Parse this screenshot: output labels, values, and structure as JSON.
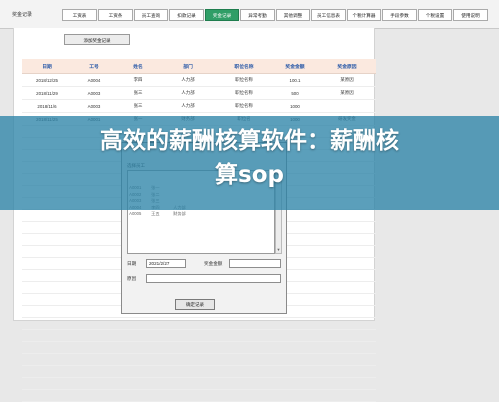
{
  "app_title": "奖金记录",
  "tabs": [
    {
      "label": "工资表",
      "active": false
    },
    {
      "label": "工资条",
      "active": false
    },
    {
      "label": "员工查询",
      "active": false
    },
    {
      "label": "扣款记录",
      "active": false
    },
    {
      "label": "奖金记录",
      "active": true
    },
    {
      "label": "异常考勤",
      "active": false
    },
    {
      "label": "其他调整",
      "active": false
    },
    {
      "label": "员工信息表",
      "active": false
    },
    {
      "label": "个税计算器",
      "active": false
    },
    {
      "label": "手段参数",
      "active": false
    },
    {
      "label": "个税设置",
      "active": false
    },
    {
      "label": "使用说明",
      "active": false
    }
  ],
  "add_button": "添加奖金记录",
  "table": {
    "headers": [
      "日期",
      "工号",
      "姓名",
      "部门",
      "职位名称",
      "奖金金额",
      "奖金原因"
    ],
    "rows": [
      [
        "2018/12/25",
        "A0004",
        "李四",
        "人力部",
        "职位名称",
        "100.1",
        "某原因"
      ],
      [
        "2018/11/29",
        "A0003",
        "张三",
        "人力部",
        "职位名称",
        "500",
        "某原因"
      ],
      [
        "2018/11/6",
        "A0003",
        "张三",
        "人力部",
        "职位名称",
        "1000",
        ""
      ],
      [
        "2018/11/25",
        "A0001",
        "张一",
        "财务部",
        "职位名",
        "1000",
        "研发奖金"
      ]
    ]
  },
  "banner": {
    "line1": "高效的薪酬核算软件：薪酬核",
    "line2": "算sop"
  },
  "dialog": {
    "list_label": "选择员工",
    "list_rows": [
      {
        "id": "A0001",
        "name": "张一",
        "dept": ""
      },
      {
        "id": "A0002",
        "name": "张二",
        "dept": ""
      },
      {
        "id": "A0003",
        "name": "张三",
        "dept": ""
      },
      {
        "id": "A0004",
        "name": "李四",
        "dept": "人力部"
      },
      {
        "id": "A0005",
        "name": "王五",
        "dept": "财务部"
      }
    ],
    "date_label": "日期",
    "date_value": "2021/2/27",
    "amount_label": "奖金金额",
    "amount_value": "",
    "reason_label": "原因",
    "reason_value": "",
    "confirm_label": "确定记录"
  }
}
